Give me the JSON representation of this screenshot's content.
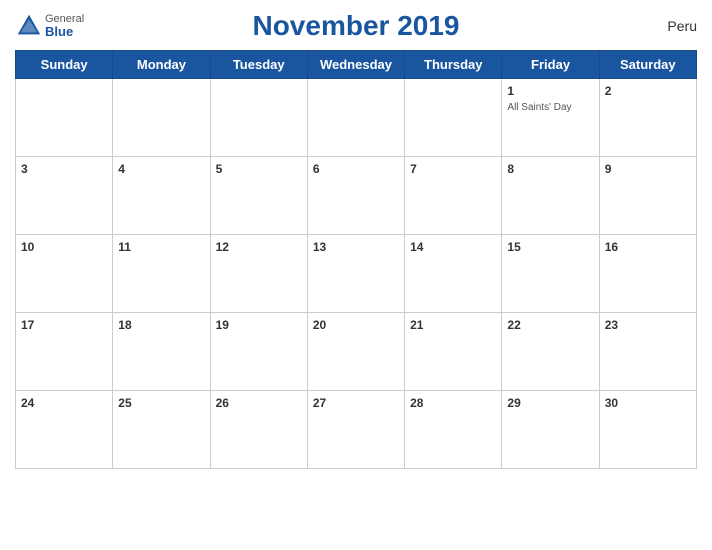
{
  "header": {
    "title": "November 2019",
    "country": "Peru",
    "logo": {
      "general": "General",
      "blue": "Blue"
    }
  },
  "weekdays": [
    "Sunday",
    "Monday",
    "Tuesday",
    "Wednesday",
    "Thursday",
    "Friday",
    "Saturday"
  ],
  "weeks": [
    [
      {
        "day": "",
        "event": ""
      },
      {
        "day": "",
        "event": ""
      },
      {
        "day": "",
        "event": ""
      },
      {
        "day": "",
        "event": ""
      },
      {
        "day": "",
        "event": ""
      },
      {
        "day": "1",
        "event": "All Saints' Day"
      },
      {
        "day": "2",
        "event": ""
      }
    ],
    [
      {
        "day": "3",
        "event": ""
      },
      {
        "day": "4",
        "event": ""
      },
      {
        "day": "5",
        "event": ""
      },
      {
        "day": "6",
        "event": ""
      },
      {
        "day": "7",
        "event": ""
      },
      {
        "day": "8",
        "event": ""
      },
      {
        "day": "9",
        "event": ""
      }
    ],
    [
      {
        "day": "10",
        "event": ""
      },
      {
        "day": "11",
        "event": ""
      },
      {
        "day": "12",
        "event": ""
      },
      {
        "day": "13",
        "event": ""
      },
      {
        "day": "14",
        "event": ""
      },
      {
        "day": "15",
        "event": ""
      },
      {
        "day": "16",
        "event": ""
      }
    ],
    [
      {
        "day": "17",
        "event": ""
      },
      {
        "day": "18",
        "event": ""
      },
      {
        "day": "19",
        "event": ""
      },
      {
        "day": "20",
        "event": ""
      },
      {
        "day": "21",
        "event": ""
      },
      {
        "day": "22",
        "event": ""
      },
      {
        "day": "23",
        "event": ""
      }
    ],
    [
      {
        "day": "24",
        "event": ""
      },
      {
        "day": "25",
        "event": ""
      },
      {
        "day": "26",
        "event": ""
      },
      {
        "day": "27",
        "event": ""
      },
      {
        "day": "28",
        "event": ""
      },
      {
        "day": "29",
        "event": ""
      },
      {
        "day": "30",
        "event": ""
      }
    ]
  ],
  "colors": {
    "header_bg": "#1a56a0",
    "header_text": "#ffffff",
    "accent": "#1a56a0"
  }
}
